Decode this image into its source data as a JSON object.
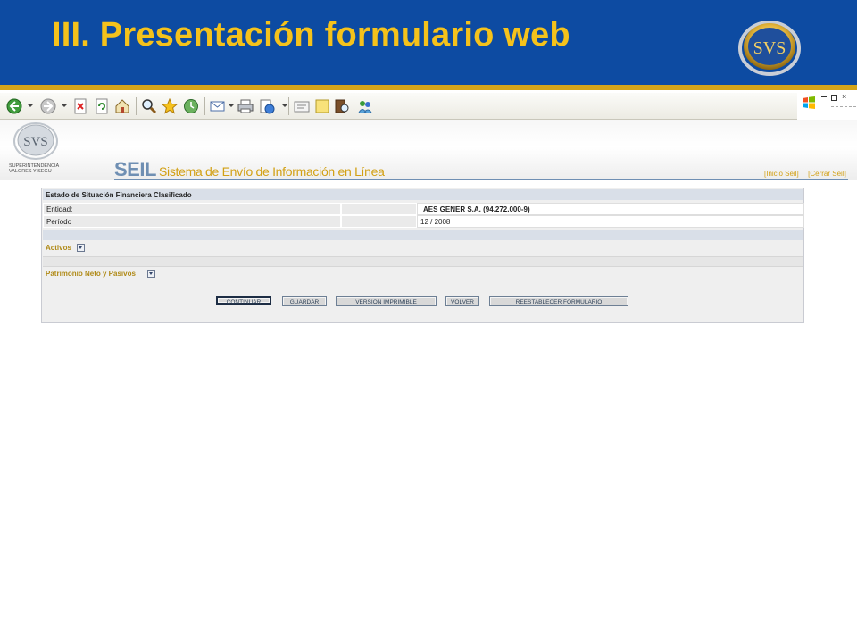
{
  "slide": {
    "title": "III. Presentación formulario web",
    "logo_text": "SVS"
  },
  "colors": {
    "slide_blue": "#0d4ba2",
    "slide_gold": "#f5c21b",
    "seil_blue": "#6f8fb3",
    "seil_gold": "#d2a014"
  },
  "toolbar": {
    "icons": [
      "back-icon",
      "forward-icon",
      "stop-icon",
      "refresh-icon",
      "home-icon",
      "search-icon",
      "favorites-icon",
      "history-icon",
      "mail-icon",
      "print-icon",
      "edit-icon",
      "discuss-icon",
      "notes-icon",
      "research-icon",
      "messenger-icon"
    ]
  },
  "page_header": {
    "org_text_line1": "SUPERINTENDENCIA",
    "org_text_line2": "VALORES Y SEGU",
    "seil": "SEIL",
    "subtitle": "Sistema de Envío de Información en Línea",
    "link_inicio": "[Inicio Seil]",
    "link_cerrar": "[Cerrar Seil]"
  },
  "form": {
    "title": "Estado de Situación Financiera Clasificado",
    "entidad_label": "Entidad:",
    "entidad_value": "AES GENER S.A. (94.272.000-9)",
    "periodo_label": "Período",
    "periodo_value": "12 / 2008",
    "section_activos": "Activos",
    "section_patrimonio": "Patrimonio Neto y Pasivos"
  },
  "buttons": {
    "continuar": "CONTINUAR",
    "guardar": "GUARDAR",
    "version_imprimible": "VERSION IMPRIMIBLE",
    "volver": "VOLVER",
    "reestablecer": "REESTABLECER FORMULARIO"
  }
}
